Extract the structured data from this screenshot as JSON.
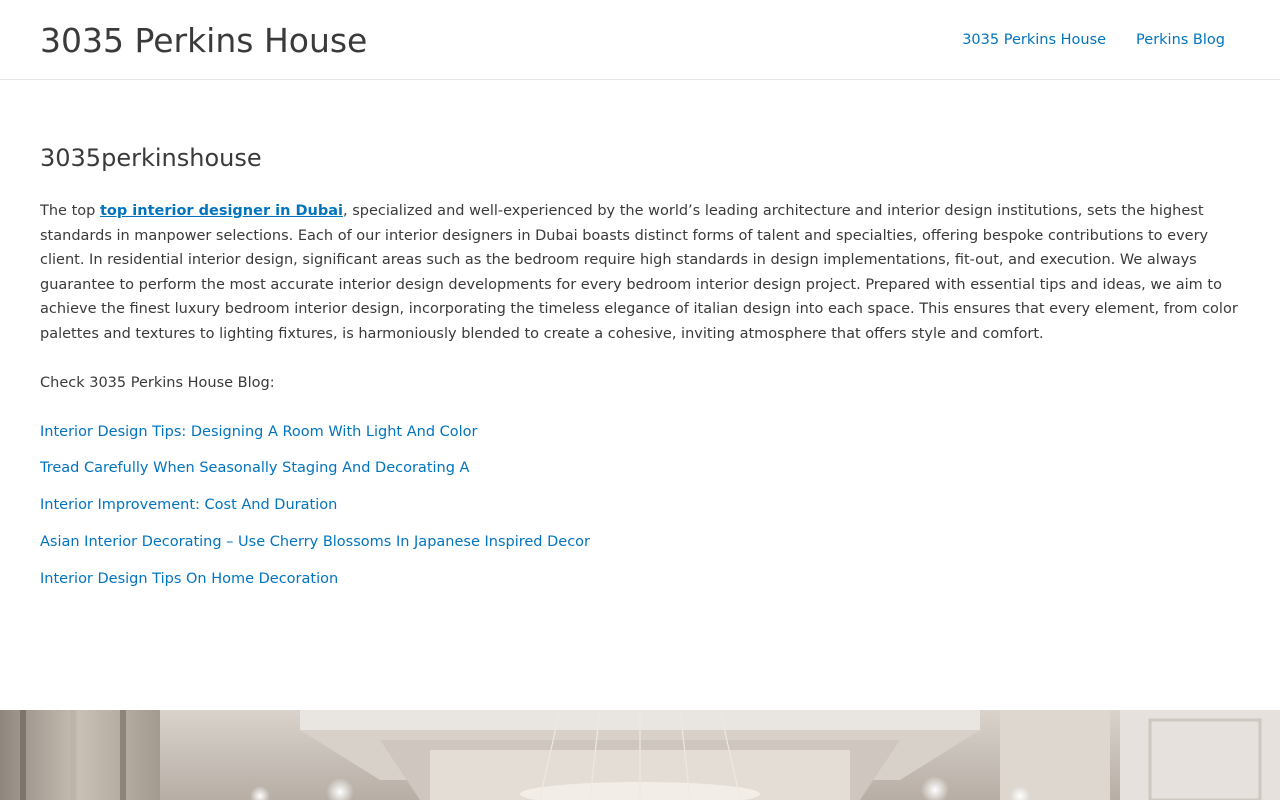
{
  "header": {
    "site_title": "3035 Perkins House",
    "nav": [
      {
        "label": "3035 Perkins House"
      },
      {
        "label": "Perkins Blog"
      }
    ]
  },
  "main": {
    "page_title": "3035perkinshouse",
    "intro_before_link": "The top ",
    "intro_link_text": "top interior designer in Dubai",
    "intro_after_link": ", specialized and well-experienced by the world’s leading architecture and interior design institutions, sets the highest standards in manpower selections. Each of our interior designers in Dubai boasts distinct forms of talent and specialties, offering bespoke contributions to every client. In residential interior design, significant areas such as the bedroom require high standards in design implementations, fit-out, and execution. We always guarantee to perform the most accurate interior design developments for every bedroom interior design project. Prepared with essential tips and ideas, we aim to achieve the finest luxury bedroom interior design, incorporating the timeless elegance of italian design into each space. This ensures that every element, from color palettes and textures to lighting fixtures, is harmoniously blended to create a cohesive, inviting atmosphere that offers style and comfort.",
    "blog_intro": "Check 3035 Perkins House Blog:",
    "posts": [
      {
        "title": "Interior Design Tips: Designing A Room With Light And Color"
      },
      {
        "title": "Tread Carefully When Seasonally Staging And Decorating A"
      },
      {
        "title": "Interior Improvement: Cost And Duration"
      },
      {
        "title": "Asian Interior Decorating – Use Cherry Blossoms In Japanese Inspired Decor"
      },
      {
        "title": "Interior Design Tips On Home Decoration"
      }
    ]
  },
  "colors": {
    "link": "#0274be",
    "text": "#3a3a3a",
    "border": "#e6e6e6"
  }
}
